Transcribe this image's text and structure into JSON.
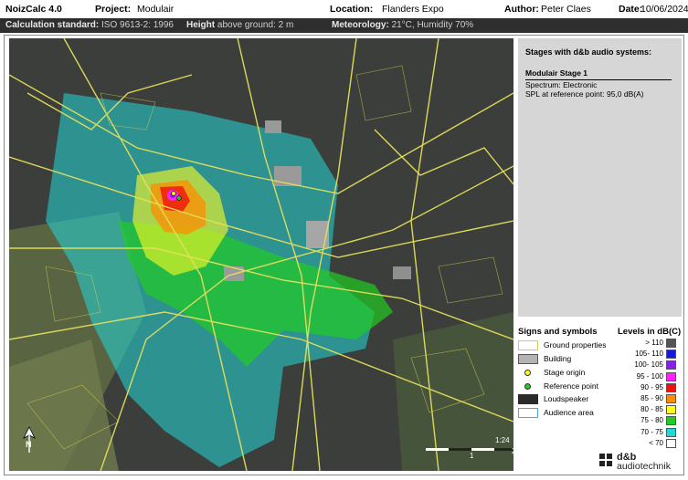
{
  "header": {
    "app": "NoizCalc 4.0",
    "project_label": "Project:",
    "project": "Modulair",
    "location_label": "Location:",
    "location": "Flanders Expo",
    "author_label": "Author:",
    "author": "Peter Claes",
    "date_label": "Date:",
    "date": "10/06/2024"
  },
  "subheader": {
    "std_label": "Calculation standard:",
    "std": "ISO 9613-2: 1996",
    "height_label": "Height",
    "height": "above ground: 2 m",
    "met_label": "Meteorology:",
    "met": "21°C, Humidity 70%"
  },
  "info_panel": {
    "title": "Stages with d&b audio systems:",
    "stage_name": "Modulair Stage 1",
    "spectrum": "Spectrum:  Electronic",
    "spl": "SPL at reference point:  95,0 dB(A)"
  },
  "signs": {
    "title": "Signs and symbols",
    "items": [
      {
        "label": "Ground properties",
        "icon": "ground-properties-swatch"
      },
      {
        "label": "Building",
        "icon": "building-swatch"
      },
      {
        "label": "Stage origin",
        "icon": "stage-origin-dot"
      },
      {
        "label": "Reference point",
        "icon": "reference-point-dot"
      },
      {
        "label": "Loudspeaker",
        "icon": "loudspeaker-swatch"
      },
      {
        "label": "Audience area",
        "icon": "audience-area-swatch"
      }
    ]
  },
  "levels": {
    "title": "Levels in dB(C)",
    "items": [
      {
        "label": "> 110",
        "color": "#555555"
      },
      {
        "label": "105-  110",
        "color": "#1818d8"
      },
      {
        "label": "100-  105",
        "color": "#8a20e8"
      },
      {
        "label": "95 -  100",
        "color": "#ff22ff"
      },
      {
        "label": "90 -   95",
        "color": "#ee1111"
      },
      {
        "label": "85 -   90",
        "color": "#ff8c00"
      },
      {
        "label": "80 -   85",
        "color": "#ffff22"
      },
      {
        "label": "75 -   80",
        "color": "#22cc22"
      },
      {
        "label": "70 -   75",
        "color": "#22d7d7"
      },
      {
        "label": "<  70",
        "color": "#ffffff"
      }
    ]
  },
  "map": {
    "scale_ratio": "1:24",
    "scale_unit": "km",
    "scale_mid": "1",
    "scale_end": "2",
    "north": "N"
  },
  "brand": {
    "line1": "d&b",
    "line2": "audiotechnik"
  }
}
